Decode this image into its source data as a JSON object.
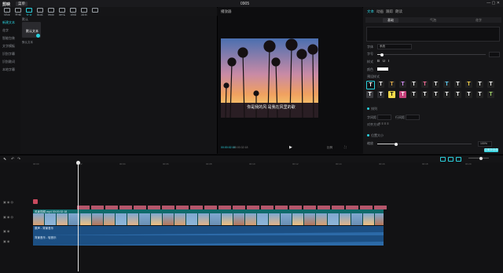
{
  "app": {
    "logo": "剪映",
    "menu_label": "菜单",
    "title": "0905"
  },
  "toolbar": {
    "tools": [
      "媒体",
      "音频",
      "文本",
      "贴纸",
      "特效",
      "转场",
      "滤镜",
      "调节"
    ],
    "active_tool": "文本"
  },
  "sidebar": {
    "items": [
      "新建文本",
      "花字",
      "智能包装",
      "文字模板",
      "识别字幕",
      "识别歌词",
      "本地字幕"
    ]
  },
  "media": {
    "section_label": "默认",
    "thumb_text": "默认文本",
    "thumb_caption": "默认文本"
  },
  "player": {
    "title": "播放器",
    "caption": "你是我的风 是我在风里的歌",
    "time_current": "00:00:02:15",
    "time_total": "00:00:32:18",
    "ratio_label": "比例"
  },
  "inspector": {
    "tabs": [
      "文本",
      "动画",
      "跟踪",
      "朗读"
    ],
    "active_tab": "文本",
    "subtabs": [
      "基础",
      "气泡",
      "花字"
    ],
    "active_subtab": "基础",
    "font_label": "字体",
    "font_value": "系统",
    "size_label": "字号",
    "style_label": "样式",
    "color_label": "颜色",
    "preset_label": "预设样式",
    "layout_label": "排列",
    "spacing_label": "字间距",
    "line_label": "行间距",
    "align_label": "对齐方式",
    "pos_label": "位置大小",
    "scale_label": "缩放",
    "scale_value": "100%",
    "apply_label": "应用到全部"
  },
  "style_presets": [
    {
      "color": "#ffffff",
      "bg": "#0f0f11"
    },
    {
      "color": "#ffffff",
      "bg": "#222"
    },
    {
      "color": "#e9b24a",
      "bg": "#222"
    },
    {
      "color": "#d48cff",
      "bg": "#222"
    },
    {
      "color": "#ffffff",
      "bg": "#222"
    },
    {
      "color": "#ff6d9a",
      "bg": "#222"
    },
    {
      "color": "#ffffff",
      "bg": "#222"
    },
    {
      "color": "#5fd0ff",
      "bg": "#222"
    },
    {
      "color": "#ffffff",
      "bg": "#222"
    },
    {
      "color": "#ffd34a",
      "bg": "#222"
    },
    {
      "color": "#ffffff",
      "bg": "#222"
    },
    {
      "color": "#ffffff",
      "bg": "#222"
    },
    {
      "color": "#ffffff",
      "bg": "#3a3a3e"
    },
    {
      "color": "#ffffff",
      "bg": "#2a2a2e"
    },
    {
      "color": "#111111",
      "bg": "#f2d84a"
    },
    {
      "color": "#ffffff",
      "bg": "#c4417a"
    },
    {
      "color": "#ffffff",
      "bg": "#222"
    },
    {
      "color": "#ffffff",
      "bg": "#222"
    },
    {
      "color": "#ffffff",
      "bg": "#222"
    },
    {
      "color": "#ffffff",
      "bg": "#222"
    },
    {
      "color": "#ffffff",
      "bg": "#222"
    },
    {
      "color": "#ffffff",
      "bg": "#222"
    },
    {
      "color": "#ffffff",
      "bg": "#222"
    },
    {
      "color": "#a4d86b",
      "bg": "#222"
    }
  ],
  "timeline": {
    "ruler": [
      "00:00",
      "00:02",
      "00:04",
      "00:06",
      "00:08",
      "00:10",
      "00:12",
      "00:14",
      "00:16",
      "00:18",
      "00:20",
      "00:22"
    ],
    "video_clip_label": "风景视频.mp4  00:00:32:18",
    "audio1_label": "原声 - 背景音乐",
    "audio2_label": "背景音乐 - 轻音乐",
    "text_clip_count": 22
  }
}
